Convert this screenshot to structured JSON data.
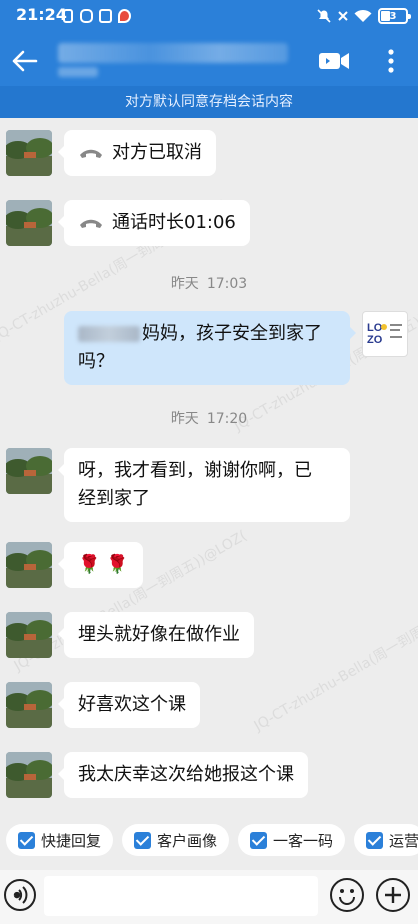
{
  "status_bar": {
    "time": "21:24",
    "battery_level": "3",
    "icons": [
      "sim-icon",
      "app-icon",
      "wallet-icon",
      "location-icon",
      "mute-icon",
      "wifi-icon",
      "battery-icon"
    ]
  },
  "header": {
    "back_icon": "back-arrow-icon",
    "video_icon": "video-call-icon",
    "more_icon": "more-vertical-icon",
    "notice": "对方默认同意存档会话内容"
  },
  "messages": [
    {
      "side": "left",
      "type": "call",
      "icon": "phone-hangup-icon",
      "text": "对方已取消"
    },
    {
      "side": "left",
      "type": "call",
      "icon": "phone-hangup-icon",
      "text": "通话时长01:06"
    },
    {
      "type": "time",
      "day": "昨天",
      "time": "17:03"
    },
    {
      "side": "right",
      "type": "text",
      "line1": "妈妈，孩子安全到家了",
      "line2": "吗？"
    },
    {
      "type": "time",
      "day": "昨天",
      "time": "17:20"
    },
    {
      "side": "left",
      "type": "text",
      "line1": "呀，我才看到，谢谢你啊，已",
      "line2": "经到家了"
    },
    {
      "side": "left",
      "type": "emoji",
      "text": "🌹 🌹"
    },
    {
      "side": "left",
      "type": "text",
      "text": "埋头就好像在做作业"
    },
    {
      "side": "left",
      "type": "text",
      "text": "好喜欢这个课"
    },
    {
      "side": "left",
      "type": "text",
      "text": "我太庆幸这次给她报这个课"
    }
  ],
  "brand_avatar": {
    "logo_line1": "LO",
    "logo_line2": "ZO"
  },
  "watermark": "JQ-CT-zhuzhu-Bella(周一到周五))@LOZ(",
  "quick_actions": [
    "快捷回复",
    "客户画像",
    "一客一码",
    "运营"
  ],
  "input": {
    "placeholder": ""
  },
  "colors": {
    "primary": "#2b80d9",
    "notice_bg": "#2477cf",
    "bubble_right": "#cfe6fb",
    "chat_bg": "#ededed"
  }
}
